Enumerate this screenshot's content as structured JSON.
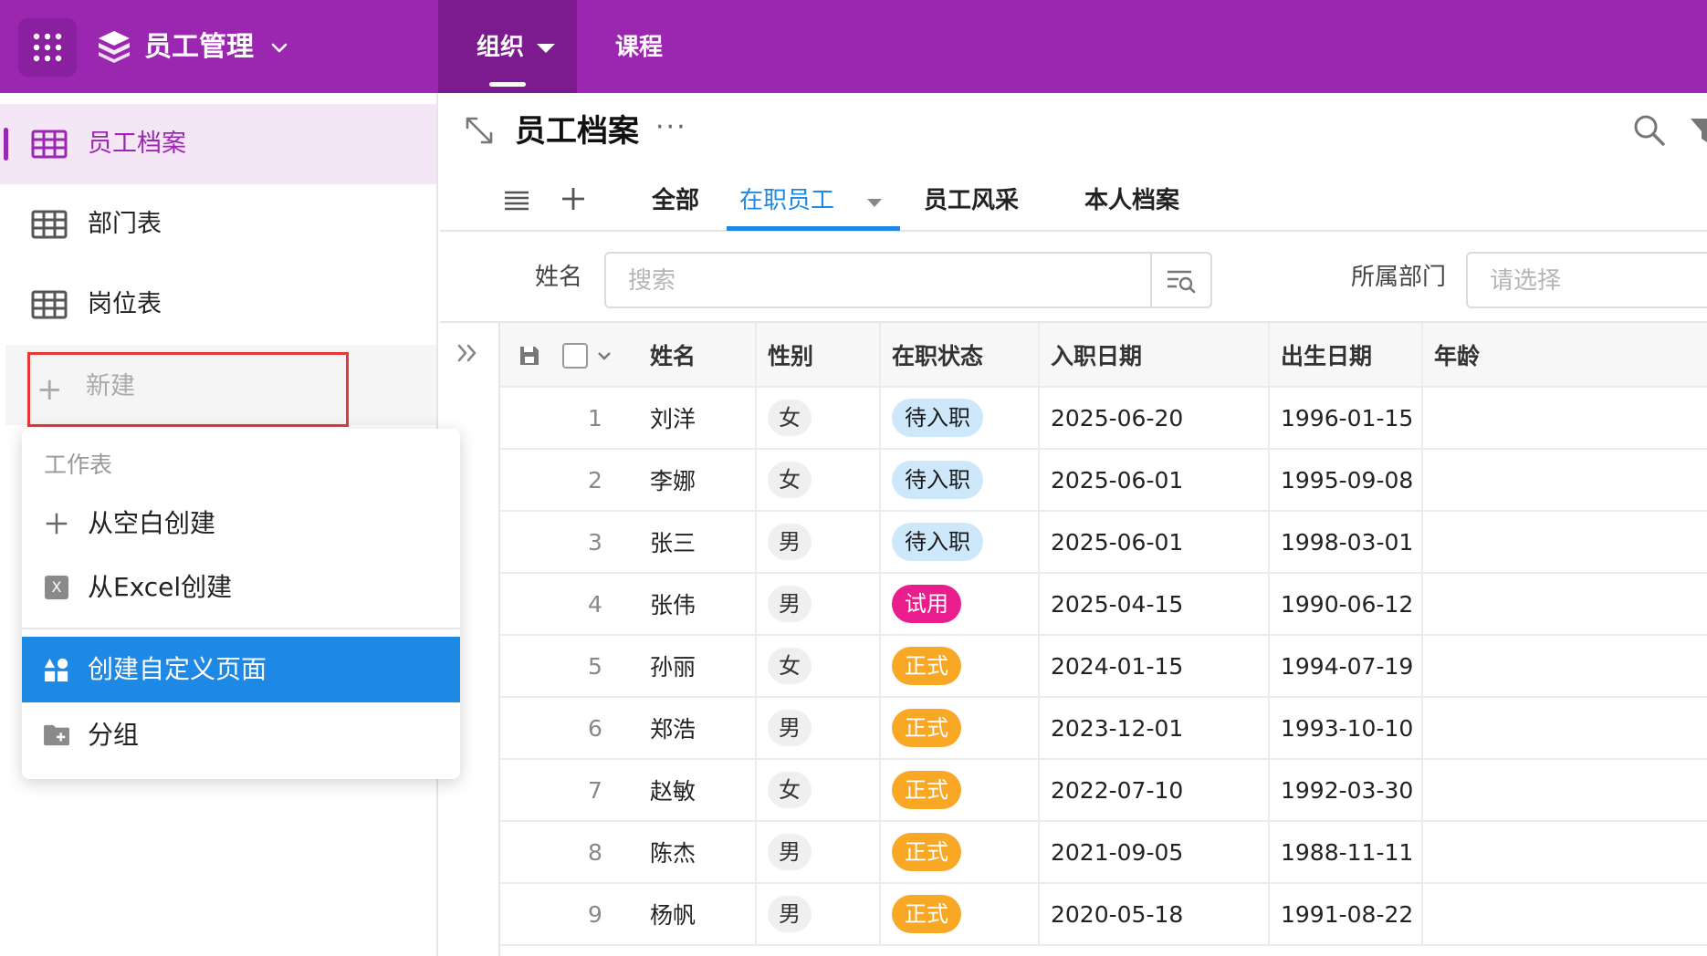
{
  "topbar": {
    "app_title": "员工管理",
    "nav": [
      {
        "label": "组织",
        "active": true
      },
      {
        "label": "课程",
        "active": false
      }
    ],
    "colors": {
      "bar": "#9b27b0",
      "active_tab": "#7c1b8f"
    }
  },
  "sidebar": {
    "items": [
      {
        "label": "员工档案",
        "icon": "table-grid-icon",
        "active": true
      },
      {
        "label": "部门表",
        "icon": "table-grid-icon",
        "active": false
      },
      {
        "label": "岗位表",
        "icon": "table-grid-icon",
        "active": false
      }
    ],
    "new_label": "新建"
  },
  "menu": {
    "section_title": "工作表",
    "items": [
      {
        "label": "从空白创建",
        "icon": "plus-icon"
      },
      {
        "label": "从Excel创建",
        "icon": "excel-icon",
        "icon_text": "X"
      },
      {
        "label": "创建自定义页面",
        "icon": "custom-page-icon",
        "selected": true
      },
      {
        "label": "分组",
        "icon": "folder-add-icon"
      }
    ]
  },
  "main": {
    "title": "员工档案",
    "more": "···",
    "views": [
      {
        "label": "全部"
      },
      {
        "label": "在职员工",
        "active": true
      },
      {
        "label": "员工风采"
      },
      {
        "label": "本人档案"
      }
    ],
    "filters": {
      "name_label": "姓名",
      "name_placeholder": "搜索",
      "dept_label": "所属部门",
      "dept_placeholder": "请选择"
    }
  },
  "table": {
    "columns": [
      "姓名",
      "性别",
      "在职状态",
      "入职日期",
      "出生日期",
      "年龄"
    ],
    "rows": [
      {
        "no": "1",
        "name": "刘洋",
        "gender": "女",
        "status": "待入职",
        "hire": "2025-06-20",
        "birth": "1996-01-15"
      },
      {
        "no": "2",
        "name": "李娜",
        "gender": "女",
        "status": "待入职",
        "hire": "2025-06-01",
        "birth": "1995-09-08"
      },
      {
        "no": "3",
        "name": "张三",
        "gender": "男",
        "status": "待入职",
        "hire": "2025-06-01",
        "birth": "1998-03-01"
      },
      {
        "no": "4",
        "name": "张伟",
        "gender": "男",
        "status": "试用",
        "hire": "2025-04-15",
        "birth": "1990-06-12"
      },
      {
        "no": "5",
        "name": "孙丽",
        "gender": "女",
        "status": "正式",
        "hire": "2024-01-15",
        "birth": "1994-07-19"
      },
      {
        "no": "6",
        "name": "郑浩",
        "gender": "男",
        "status": "正式",
        "hire": "2023-12-01",
        "birth": "1993-10-10"
      },
      {
        "no": "7",
        "name": "赵敏",
        "gender": "女",
        "status": "正式",
        "hire": "2022-07-10",
        "birth": "1992-03-30"
      },
      {
        "no": "8",
        "name": "陈杰",
        "gender": "男",
        "status": "正式",
        "hire": "2021-09-05",
        "birth": "1988-11-11"
      },
      {
        "no": "9",
        "name": "杨帆",
        "gender": "男",
        "status": "正式",
        "hire": "2020-05-18",
        "birth": "1991-08-22"
      }
    ],
    "status_colors": {
      "待入职": {
        "bg": "#cde7fb",
        "fg": "#1a1a1a"
      },
      "试用": {
        "bg": "#e91e8c",
        "fg": "#ffffff"
      },
      "正式": {
        "bg": "#f9a825",
        "fg": "#ffffff"
      }
    }
  }
}
